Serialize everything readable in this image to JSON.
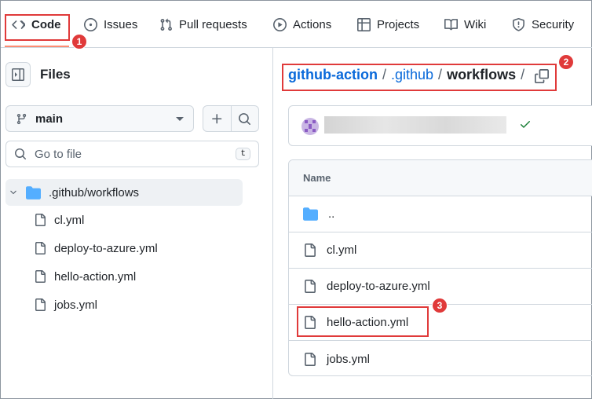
{
  "nav": {
    "tabs": [
      {
        "label": "Code",
        "icon": "code-icon"
      },
      {
        "label": "Issues",
        "icon": "issue-icon"
      },
      {
        "label": "Pull requests",
        "icon": "pull-request-icon"
      },
      {
        "label": "Actions",
        "icon": "play-icon"
      },
      {
        "label": "Projects",
        "icon": "table-icon"
      },
      {
        "label": "Wiki",
        "icon": "book-icon"
      },
      {
        "label": "Security",
        "icon": "shield-icon"
      }
    ]
  },
  "sidebar": {
    "title": "Files",
    "branch": "main",
    "goto_placeholder": "Go to file",
    "goto_shortcut": "t",
    "tree": {
      "folder": ".github/workflows",
      "files": [
        "cl.yml",
        "deploy-to-azure.yml",
        "hello-action.yml",
        "jobs.yml"
      ]
    }
  },
  "breadcrumb": {
    "repo": "github-action",
    "sep1": "/",
    "dir1": ".github",
    "sep2": "/",
    "current": "workflows",
    "sep3": "/"
  },
  "table": {
    "header": "Name",
    "parent": "..",
    "files": [
      "cl.yml",
      "deploy-to-azure.yml",
      "hello-action.yml",
      "jobs.yml"
    ]
  },
  "annotations": {
    "badge1": "1",
    "badge2": "2",
    "badge3": "3",
    "color": "#e03a3a"
  },
  "colors": {
    "link": "#0969da",
    "folder": "#54aeff",
    "success": "#1a7f37",
    "tab_underline": "#fd8c73"
  }
}
